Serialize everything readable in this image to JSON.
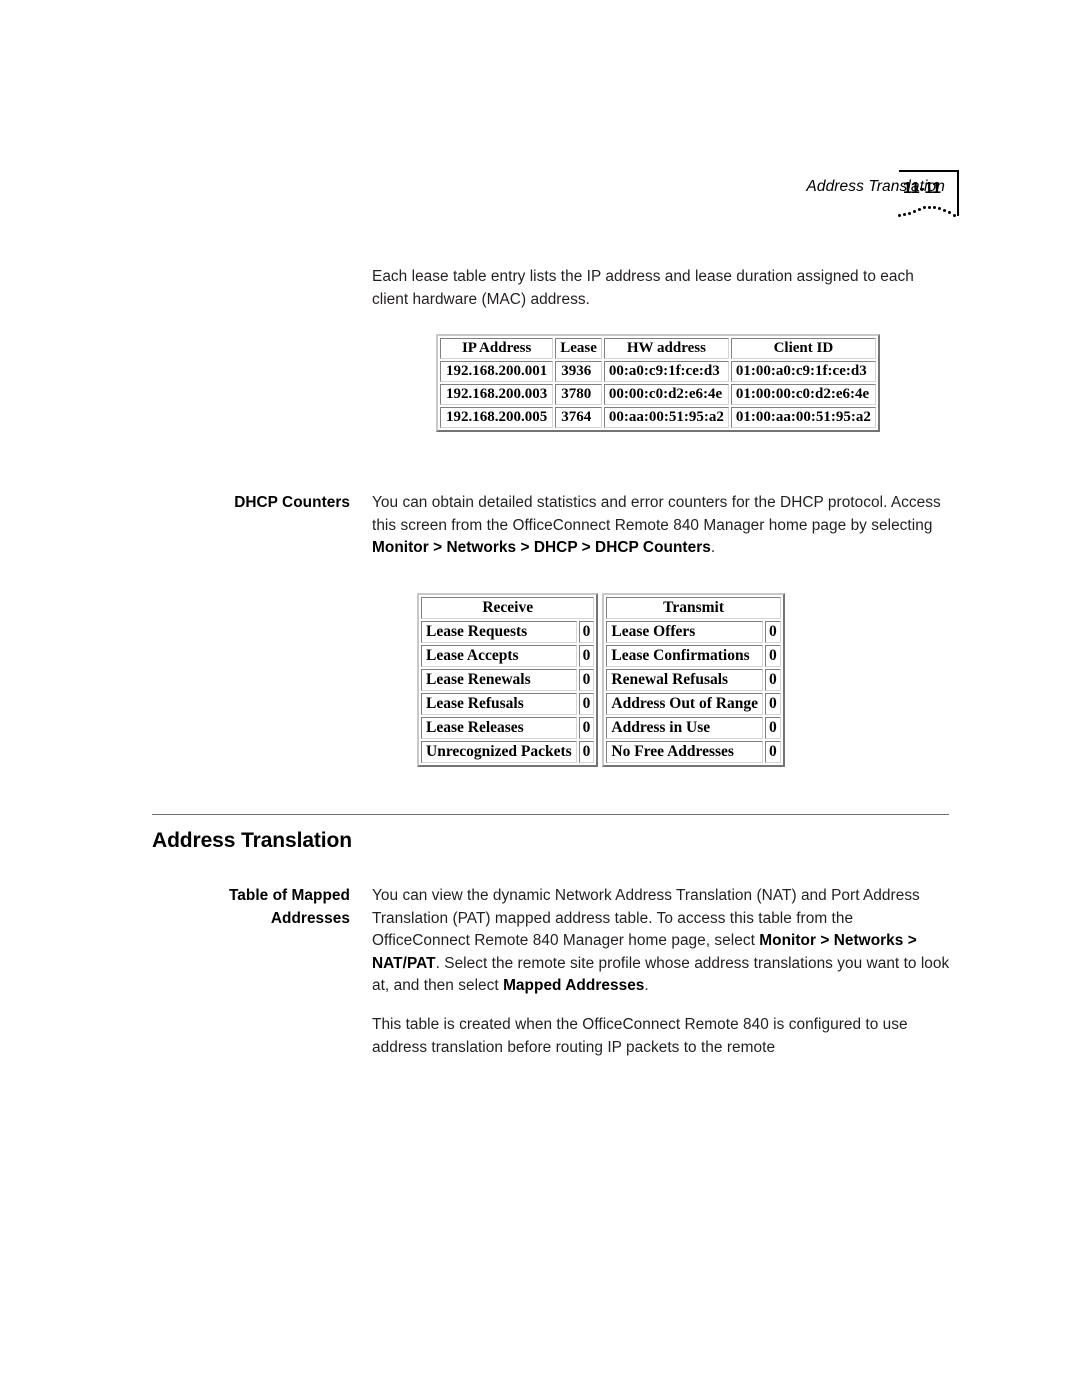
{
  "header": {
    "chapter": "Address Translation",
    "page_number": "11-11"
  },
  "intro_paragraph": "Each lease table entry lists the IP address and lease duration assigned to each client hardware (MAC) address.",
  "lease_table": {
    "columns": [
      "IP Address",
      "Lease",
      "HW address",
      "Client ID"
    ],
    "rows": [
      {
        "ip": "192.168.200.001",
        "lease": "3936",
        "hw": "00:a0:c9:1f:ce:d3",
        "client_id": "01:00:a0:c9:1f:ce:d3"
      },
      {
        "ip": "192.168.200.003",
        "lease": "3780",
        "hw": "00:00:c0:d2:e6:4e",
        "client_id": "01:00:00:c0:d2:e6:4e"
      },
      {
        "ip": "192.168.200.005",
        "lease": "3764",
        "hw": "00:aa:00:51:95:a2",
        "client_id": "01:00:aa:00:51:95:a2"
      }
    ]
  },
  "dhcp_counters_section": {
    "label": "DHCP Counters",
    "body_part_1": "You can obtain detailed statistics and error counters for the DHCP protocol. Access this screen from the OfficeConnect Remote 840 Manager home page by selecting ",
    "body_bold_1": "Monitor > Networks > DHCP > DHCP Counters",
    "body_part_2": "."
  },
  "counters_table": {
    "receive_title": "Receive",
    "transmit_title": "Transmit",
    "receive_rows": [
      {
        "label": "Lease Requests",
        "value": "0"
      },
      {
        "label": "Lease Accepts",
        "value": "0"
      },
      {
        "label": "Lease Renewals",
        "value": "0"
      },
      {
        "label": "Lease Refusals",
        "value": "0"
      },
      {
        "label": "Lease Releases",
        "value": "0"
      },
      {
        "label": "Unrecognized Packets",
        "value": "0"
      }
    ],
    "transmit_rows": [
      {
        "label": "Lease Offers",
        "value": "0"
      },
      {
        "label": "Lease Confirmations",
        "value": "0"
      },
      {
        "label": "Renewal Refusals",
        "value": "0"
      },
      {
        "label": "Address Out of Range",
        "value": "0"
      },
      {
        "label": "Address in Use",
        "value": "0"
      },
      {
        "label": "No Free Addresses",
        "value": "0"
      }
    ]
  },
  "address_translation_section": {
    "heading": "Address Translation",
    "label": "Table of Mapped Addresses",
    "para1_a": "You can view the dynamic Network Address Translation (NAT) and Port Address Translation (PAT) mapped address table. To access this table from the OfficeConnect Remote 840 Manager home page, select ",
    "para1_b": "Monitor > Networks > NAT/PAT",
    "para1_c": ". Select the remote site profile whose address translations you want to look at, and then select ",
    "para1_d": "Mapped Addresses",
    "para1_e": ".",
    "para2": "This table is created when the OfficeConnect Remote 840 is configured to use address translation before routing IP packets to the remote"
  }
}
